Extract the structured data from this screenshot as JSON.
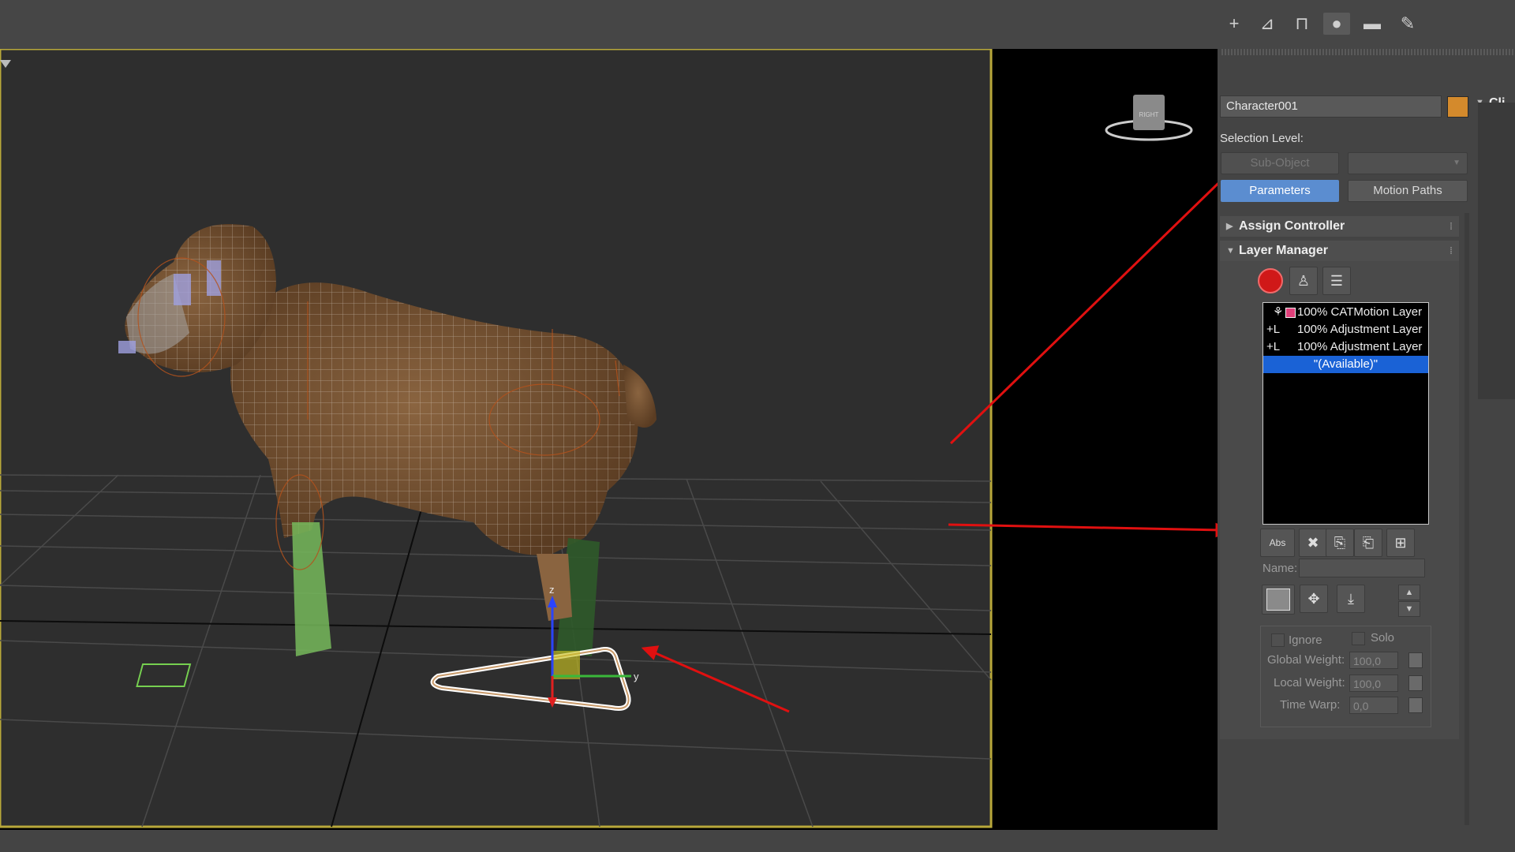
{
  "viewport": {
    "name": "3d-viewport",
    "viewcube_label": "RIGHT",
    "filter_icon": "funnel-icon"
  },
  "command_panel": {
    "tabs": [
      {
        "icon": "create-plus-icon",
        "glyph": "+"
      },
      {
        "icon": "modify-icon",
        "glyph": "⌷"
      },
      {
        "icon": "hierarchy-icon",
        "glyph": "⊓"
      },
      {
        "icon": "motion-icon",
        "glyph": "●"
      },
      {
        "icon": "display-icon",
        "glyph": "▬"
      },
      {
        "icon": "utilities-wrench-icon",
        "glyph": "✎"
      }
    ],
    "object_name": "Character001",
    "object_color": "#d48a2c",
    "clip_label": "Cli",
    "selection_level_label": "Selection Level:",
    "sub_object_button": "Sub-Object",
    "parameters_button": "Parameters",
    "motion_paths_button": "Motion Paths"
  },
  "rollouts": {
    "assign_controller": "Assign Controller",
    "layer_manager": "Layer Manager"
  },
  "layer_manager": {
    "layers": [
      {
        "prefix": "",
        "text": "100% CATMotion Layer",
        "color": "#e0407a"
      },
      {
        "prefix": "+L",
        "text": "100% Adjustment Layer"
      },
      {
        "prefix": "+L",
        "text": "100% Adjustment Layer"
      }
    ],
    "available": "\"(Available)\"",
    "add_layer_label": "Abs",
    "name_label": "Name:",
    "ignore_label": "Ignore",
    "solo_label": "Solo",
    "global_weight_label": "Global Weight:",
    "global_weight_value": "100,0",
    "local_weight_label": "Local Weight:",
    "local_weight_value": "100,0",
    "time_warp_label": "Time Warp:",
    "time_warp_value": "0,0"
  },
  "colors": {
    "viewport_border": "#b8a83a",
    "annotation_arrow": "#e01010",
    "selection_blue": "#1a62d6",
    "parameters_blue": "#5b8dd0"
  }
}
